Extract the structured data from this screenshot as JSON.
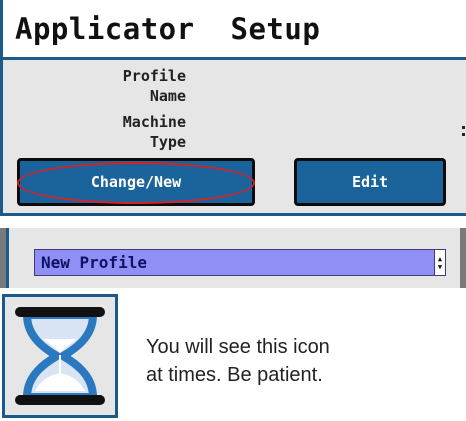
{
  "setup_panel": {
    "title": "Applicator  Setup",
    "fields": [
      {
        "label_line1": "Profile",
        "label_line2": "Name"
      },
      {
        "label_line1": "Machine",
        "label_line2": "Type"
      }
    ],
    "change_new_label": "Change/New",
    "edit_label": "Edit",
    "highlight_color": "#d2232a",
    "button_color": "#1b639b"
  },
  "profile_panel": {
    "selected_profile": "New Profile",
    "field_color": "#8f8ff5"
  },
  "hourglass_tip": {
    "icon": "hourglass-icon",
    "line1": "You will see this icon",
    "line2": "at times. Be patient."
  }
}
